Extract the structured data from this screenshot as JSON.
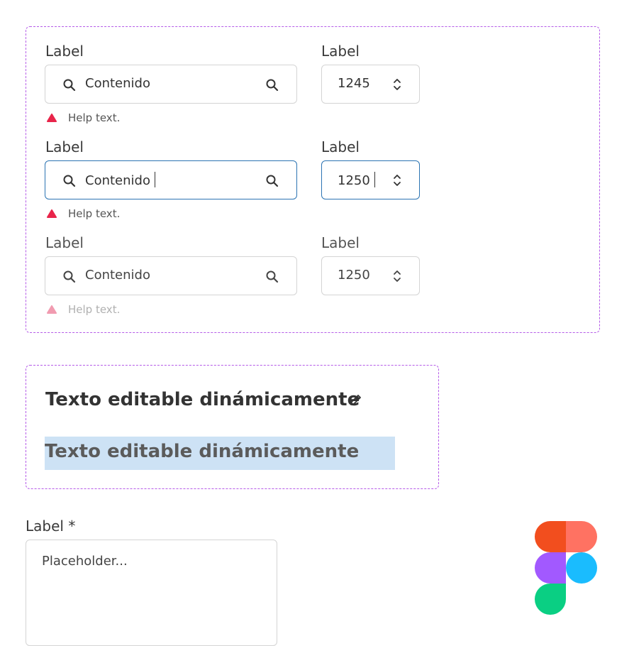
{
  "colors": {
    "frame_border": "#b55be8",
    "focus_border": "#2c74b3",
    "warning_red": "#e8254a",
    "warning_red_disabled": "#f19bb0",
    "selection_bg": "#cde2f5"
  },
  "icons": {
    "search": "search-icon",
    "stepper": "chevron-up-down-icon",
    "warning": "warning-triangle-icon",
    "edit": "pencil-icon",
    "figma": "figma-logo"
  },
  "rows": [
    {
      "state": "default",
      "search_label": "Label",
      "search_value": "Contenido",
      "number_label": "Label",
      "number_value": "1245",
      "help_text": "Help text."
    },
    {
      "state": "focused",
      "search_label": "Label",
      "search_value": "Contenido",
      "number_label": "Label",
      "number_value": "1250",
      "help_text": "Help text."
    },
    {
      "state": "disabled",
      "search_label": "Label",
      "search_value": "Contenido",
      "number_label": "Label",
      "number_value": "1250",
      "help_text": "Help text."
    }
  ],
  "editable": {
    "title": "Texto editable dinámicamente",
    "selected_text": "Texto editable dinámicamente"
  },
  "textarea": {
    "label": "Label *",
    "placeholder": "Placeholder..."
  }
}
